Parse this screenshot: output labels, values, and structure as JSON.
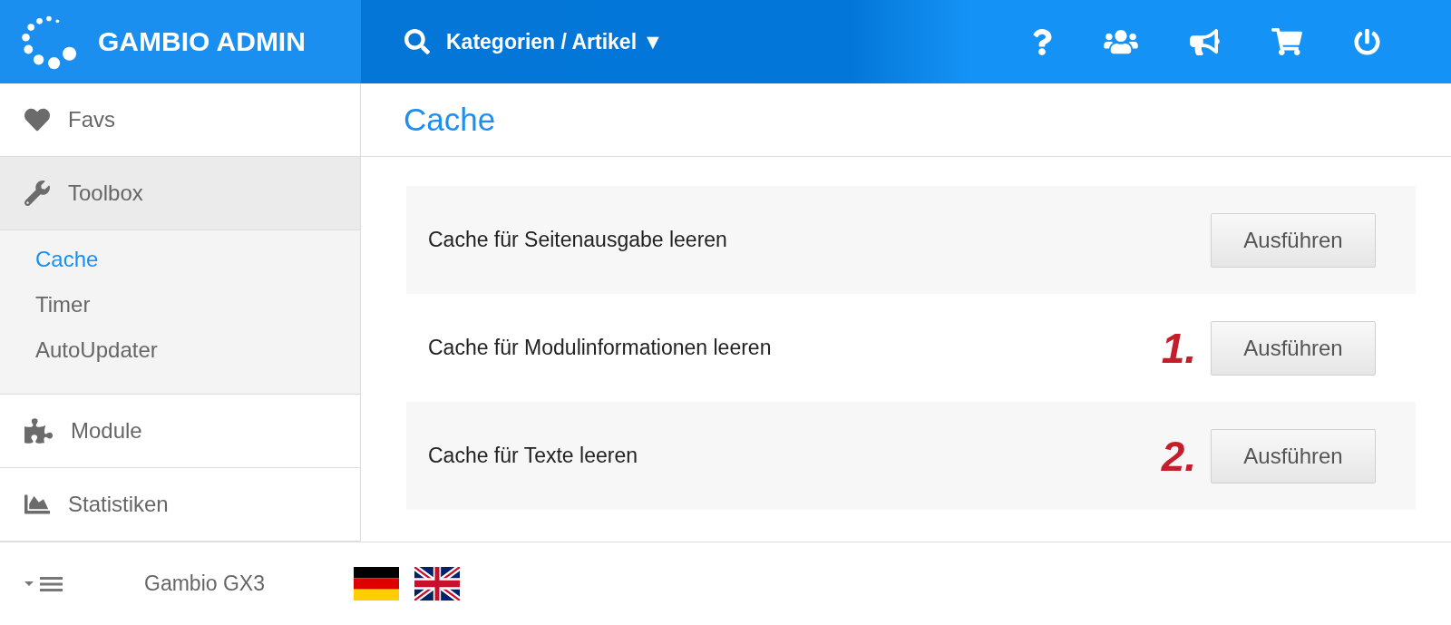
{
  "header": {
    "title": "GAMBIO ADMIN",
    "search": {
      "label": "Kategorien / Artikel ▼"
    }
  },
  "sidebar": {
    "items": [
      {
        "label": "Favs",
        "expanded": false
      },
      {
        "label": "Toolbox",
        "expanded": true,
        "children": [
          {
            "label": "Cache",
            "selected": true
          },
          {
            "label": "Timer",
            "selected": false
          },
          {
            "label": "AutoUpdater",
            "selected": false
          }
        ]
      },
      {
        "label": "Module",
        "expanded": false
      },
      {
        "label": "Statistiken",
        "expanded": false
      }
    ]
  },
  "main": {
    "title": "Cache",
    "rows": [
      {
        "label": "Cache für Seitenausgabe leeren",
        "button": "Ausführen"
      },
      {
        "label": "Cache für Modulinformationen leeren",
        "marker": "1.",
        "button": "Ausführen"
      },
      {
        "label": "Cache für Texte leeren",
        "marker": "2.",
        "button": "Ausführen"
      }
    ]
  },
  "footer": {
    "version": "Gambio GX3"
  }
}
